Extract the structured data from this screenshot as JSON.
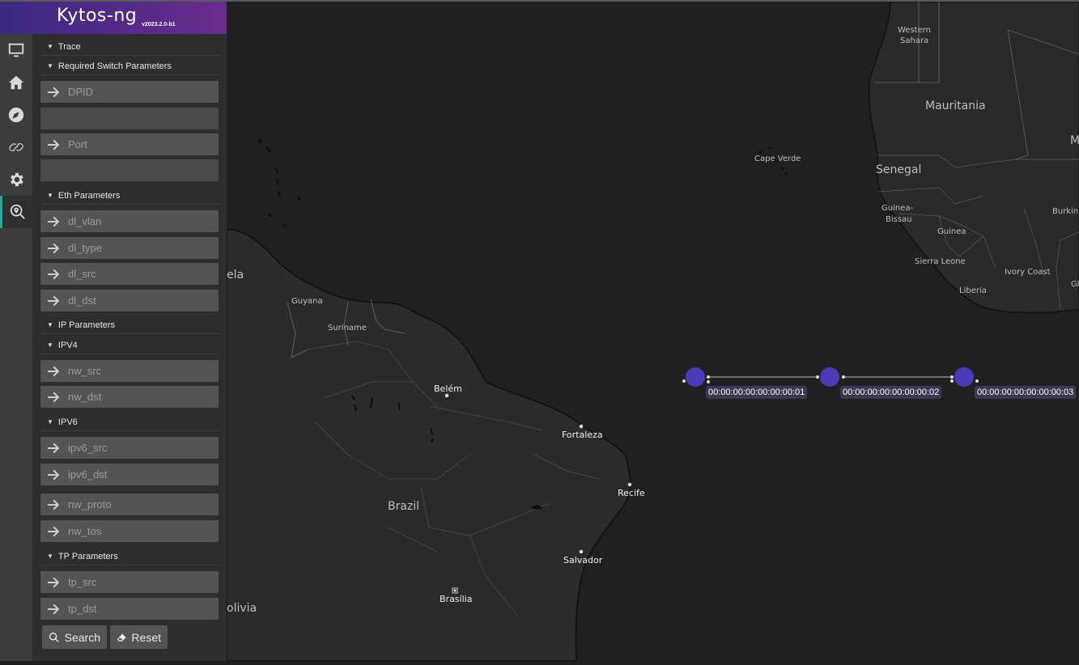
{
  "app": {
    "logo_text": "Kytos-ng",
    "version": "v2023.2.0-b1"
  },
  "rail": [
    {
      "icon": "monitor-icon"
    },
    {
      "icon": "home-icon"
    },
    {
      "icon": "compass-icon"
    },
    {
      "icon": "link-icon"
    },
    {
      "icon": "gear-icon"
    },
    {
      "icon": "search-location-icon",
      "active": true
    }
  ],
  "panel": {
    "trace": "Trace",
    "required": "Required Switch Parameters",
    "dpid_placeholder": "DPID",
    "port_placeholder": "Port",
    "eth": "Eth Parameters",
    "dl_vlan": "dl_vlan",
    "dl_type": "dl_type",
    "dl_src": "dl_src",
    "dl_dst": "dl_dst",
    "ip": "IP Parameters",
    "ipv4": "IPV4",
    "nw_src": "nw_src",
    "nw_dst": "nw_dst",
    "ipv6": "IPV6",
    "ipv6_src": "ipv6_src",
    "ipv6_dst": "ipv6_dst",
    "nw_proto": "nw_proto",
    "nw_tos": "nw_tos",
    "tp": "TP Parameters",
    "tp_src": "tp_src",
    "tp_dst": "tp_dst",
    "search_btn": "Search",
    "reset_btn": "Reset"
  },
  "map": {
    "labels": {
      "western_sahara_1": "Western",
      "western_sahara_2": "Sahara",
      "mauritania": "Mauritania",
      "m_cut": "M",
      "cape_verde": "Cape Verde",
      "senegal": "Senegal",
      "guinea_bissau_1": "Guinea-",
      "guinea_bissau_2": "Bissau",
      "guinea": "Guinea",
      "burkina": "Burkin",
      "sierra_leone": "Sierra Leone",
      "ivory_coast": "Ivory Coast",
      "liberia": "Liberia",
      "gh_cut": "Gh",
      "venezuela_cut": "ela",
      "guyana": "Guyana",
      "suriname": "Suriname",
      "belem": "Belém",
      "fortaleza": "Fortaleza",
      "recife": "Recife",
      "brazil": "Brazil",
      "salvador": "Salvador",
      "brasilia": "Brasília",
      "bolivia_cut": "olivia"
    }
  },
  "topology": {
    "node_color": "#4b3ab8",
    "switches": [
      {
        "dpid": "00:00:00:00:00:00:00:01"
      },
      {
        "dpid": "00:00:00:00:00:00:00:02"
      },
      {
        "dpid": "00:00:00:00:00:00:00:03"
      }
    ]
  }
}
